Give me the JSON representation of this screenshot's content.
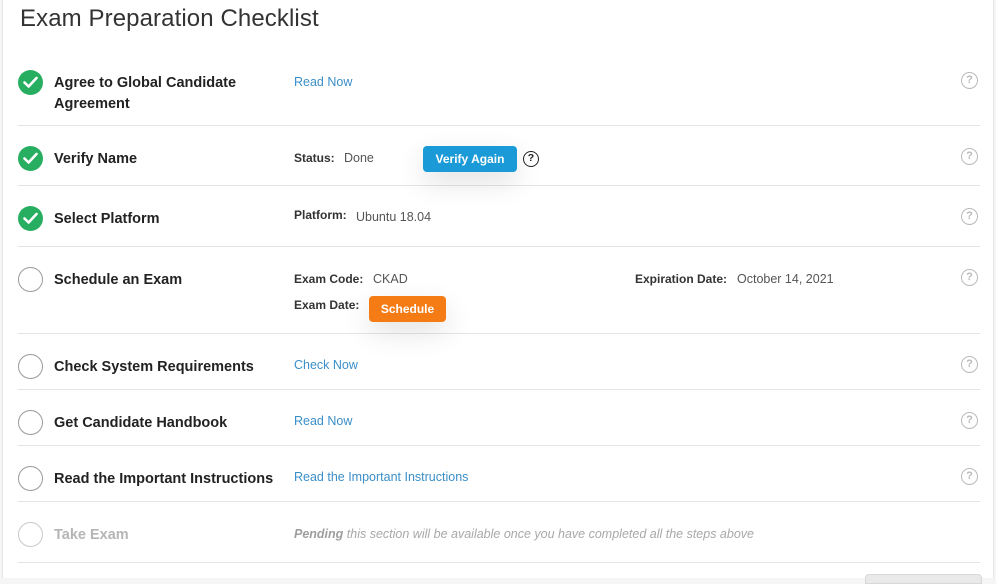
{
  "page": {
    "title": "Exam Preparation Checklist"
  },
  "colors": {
    "done": "#27ae60",
    "link": "#3a8fc9",
    "verify_button": "#1a9ad6",
    "schedule_button": "#f57c15"
  },
  "steps": [
    {
      "name_line1": "Agree to Global Candidate",
      "name_line2": "Agreement",
      "status": "done",
      "link": "Read Now",
      "help_icon": "question-circle-icon"
    },
    {
      "name": "Verify Name",
      "status": "done",
      "status_label": "Status:",
      "status_value": "Done",
      "button": "Verify Again",
      "help_icon": "question-circle-icon"
    },
    {
      "name": "Select Platform",
      "status": "done",
      "platform_label": "Platform:",
      "platform_value": "Ubuntu 18.04",
      "help_icon": "question-circle-icon"
    },
    {
      "name": "Schedule an Exam",
      "status": "pending",
      "exam_code_label": "Exam Code:",
      "exam_code_value": "CKAD",
      "expiration_label": "Expiration Date:",
      "expiration_value": "October 14, 2021",
      "exam_date_label": "Exam Date:",
      "button": "Schedule",
      "help_icon": "question-circle-icon"
    },
    {
      "name": "Check System Requirements",
      "status": "pending",
      "link": "Check Now",
      "help_icon": "question-circle-icon"
    },
    {
      "name": "Get Candidate Handbook",
      "status": "pending",
      "link": "Read Now",
      "help_icon": "question-circle-icon"
    },
    {
      "name": "Read the Important Instructions",
      "status": "pending",
      "link": "Read the Important Instructions",
      "help_icon": "question-circle-icon"
    },
    {
      "name": "Take Exam",
      "status": "disabled",
      "pending_bold": "Pending",
      "pending_text": "this section will be available once you have completed all the steps above"
    }
  ],
  "help_glyph": "?"
}
